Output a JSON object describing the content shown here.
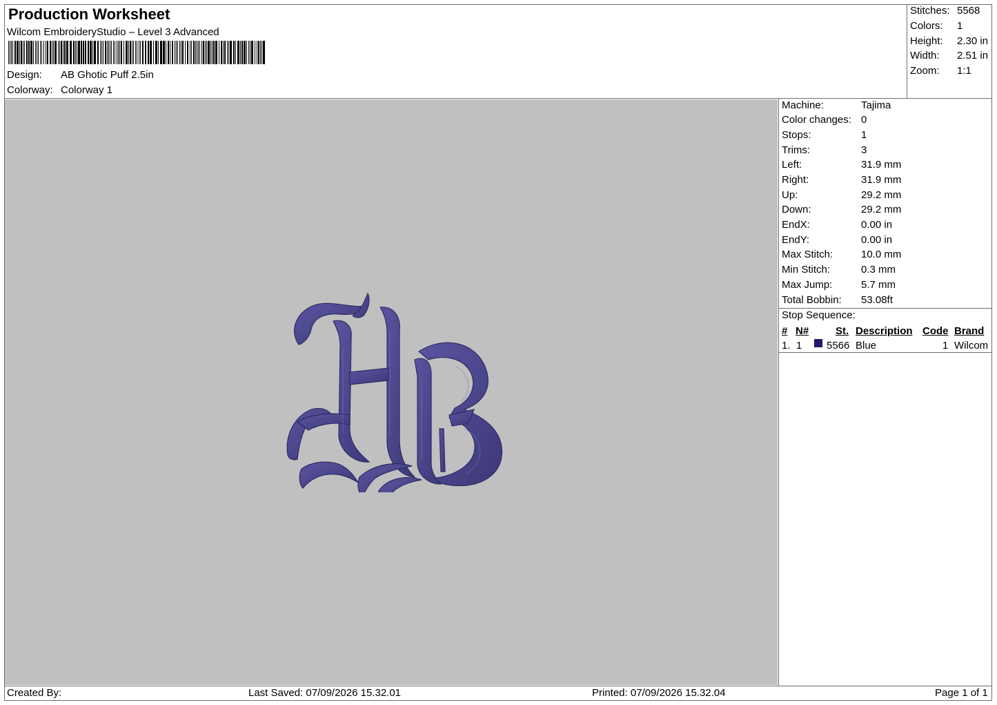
{
  "header": {
    "title": "Production Worksheet",
    "software": "Wilcom EmbroideryStudio – Level 3 Advanced",
    "design_label": "Design:",
    "design_value": "AB Ghotic Puff 2.5in",
    "colorway_label": "Colorway:",
    "colorway_value": "Colorway 1"
  },
  "summary": [
    {
      "label": "Stitches:",
      "value": "5568"
    },
    {
      "label": "Colors:",
      "value": "1"
    },
    {
      "label": "Height:",
      "value": "2.30 in"
    },
    {
      "label": "Width:",
      "value": "2.51 in"
    },
    {
      "label": "Zoom:",
      "value": "1:1"
    }
  ],
  "machine_info": [
    {
      "label": "Machine:",
      "value": "Tajima"
    },
    {
      "label": "Color changes:",
      "value": "0"
    },
    {
      "label": "Stops:",
      "value": "1"
    },
    {
      "label": "Trims:",
      "value": "3"
    },
    {
      "label": "Left:",
      "value": "31.9 mm"
    },
    {
      "label": "Right:",
      "value": "31.9 mm"
    },
    {
      "label": "Up:",
      "value": "29.2 mm"
    },
    {
      "label": "Down:",
      "value": "29.2 mm"
    },
    {
      "label": "EndX:",
      "value": "0.00 in"
    },
    {
      "label": "EndY:",
      "value": "0.00 in"
    },
    {
      "label": "Max Stitch:",
      "value": "10.0 mm"
    },
    {
      "label": "Min Stitch:",
      "value": "0.3 mm"
    },
    {
      "label": "Max Jump:",
      "value": "5.7 mm"
    },
    {
      "label": "Total Bobbin:",
      "value": "53.08ft"
    }
  ],
  "stop_sequence": {
    "title": "Stop Sequence:",
    "columns": [
      "#",
      "N#",
      "St.",
      "Description",
      "Code",
      "Brand"
    ],
    "rows": [
      {
        "index": "1.",
        "needle": "1",
        "stitches": "5566",
        "description": "Blue",
        "code": "1",
        "brand": "Wilcom",
        "color": "#1f1a6b"
      }
    ]
  },
  "footer": {
    "created_by": "Created By:",
    "last_saved": "Last Saved: 07/09/2026 15.32.01",
    "printed": "Printed: 07/09/2026 15.32.04",
    "page": "Page 1 of 1"
  },
  "colors": {
    "preview_background": "#c0c0c0",
    "thread": "#4b4688",
    "thread_swatch": "#1f1a6b"
  }
}
